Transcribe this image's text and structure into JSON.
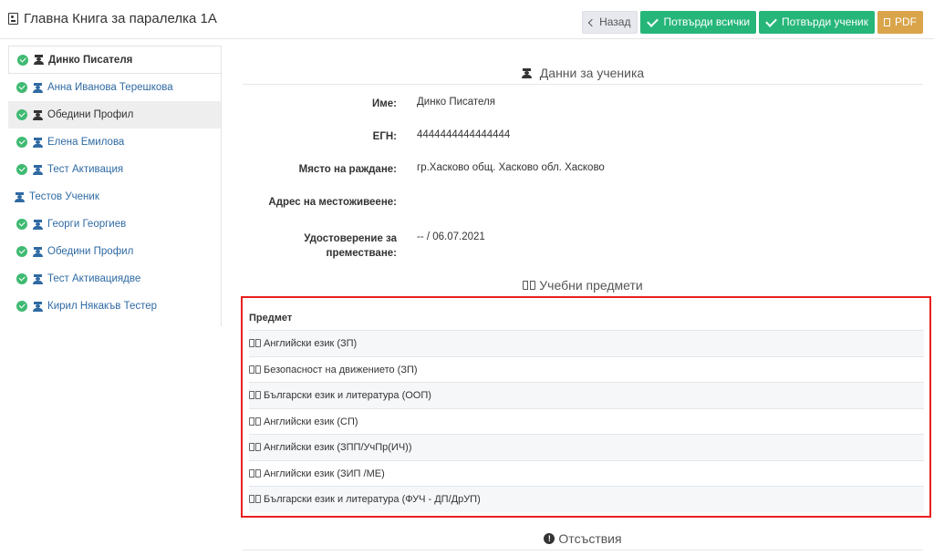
{
  "header": {
    "title": "Главна Книга за паралелка 1А",
    "buttons": {
      "back": "Назад",
      "confirm_all": "Потвърди всички",
      "confirm_student": "Потвърди ученик",
      "pdf": "PDF"
    }
  },
  "sidebar": {
    "items": [
      {
        "label": "Динко Писателя",
        "checked": true
      },
      {
        "label": "Анна Иванова Терешкова",
        "checked": true
      },
      {
        "label": "Обедини Профил",
        "checked": true
      },
      {
        "label": "Елена Емилова",
        "checked": true
      },
      {
        "label": "Тест Активация",
        "checked": true
      },
      {
        "label": "Тестов Ученик",
        "checked": false
      },
      {
        "label": "Георги Георгиев",
        "checked": true
      },
      {
        "label": "Обедини Профил",
        "checked": true
      },
      {
        "label": "Тест Активациядве",
        "checked": true
      },
      {
        "label": "Кирил Някакъв Тестер",
        "checked": true
      }
    ]
  },
  "student": {
    "section_title": "Данни за ученика",
    "fields": [
      {
        "label": "Име:",
        "value": "Динко Писателя"
      },
      {
        "label": "ЕГН:",
        "value": "4444444444444444"
      },
      {
        "label": "Място на раждане:",
        "value": "гр.Хасково общ. Хасково обл. Хасково"
      },
      {
        "label": "Адрес на местоживеене:",
        "value": ""
      },
      {
        "label": "Удостоверение за преместване:",
        "value": "-- / 06.07.2021"
      }
    ]
  },
  "subjects": {
    "section_title": "Учебни предмети",
    "column_header": "Предмет",
    "rows": [
      "Английски език (ЗП)",
      "Безопасност на движението (ЗП)",
      "Български език и литература (ООП)",
      "Английски език (СП)",
      "Английски език (ЗПП/УчПр(ИЧ))",
      "Английски език (ЗИП /МЕ)",
      "Български език и литература (ФУЧ - ДП/ДрУП)"
    ]
  },
  "absences": {
    "section_title": "Отсъствия"
  },
  "colors": {
    "green": "#26b67a",
    "pdf": "#d9a44a",
    "highlight_border": "#e8201e",
    "link": "#2f6aa3"
  }
}
